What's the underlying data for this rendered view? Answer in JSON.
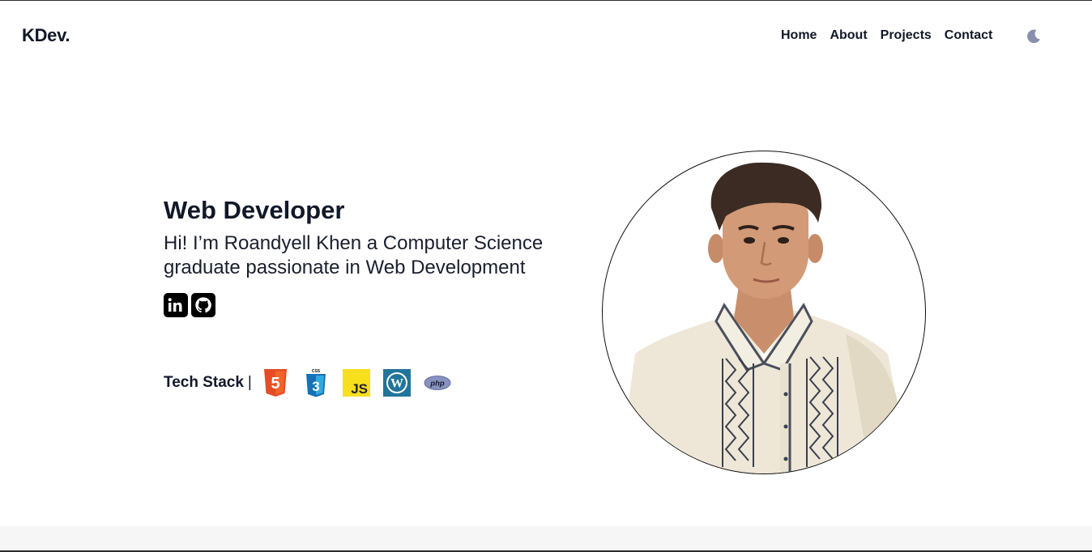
{
  "brand": {
    "logo": "KDev."
  },
  "nav": {
    "items": [
      {
        "label": "Home"
      },
      {
        "label": "About"
      },
      {
        "label": "Projects"
      },
      {
        "label": "Contact"
      }
    ],
    "theme_toggle_icon": "moon-icon"
  },
  "hero": {
    "title": "Web Developer",
    "intro": "Hi! I’m Roandyell Khen a Computer Science graduate passionate in Web Development",
    "socials": [
      {
        "icon": "linkedin-icon",
        "label": "in"
      },
      {
        "icon": "github-icon"
      }
    ],
    "portrait_icon": "profile-photo"
  },
  "tech_stack": {
    "label": "Tech Stack",
    "separator": "|",
    "items": [
      {
        "icon": "html5-icon",
        "badge": "5"
      },
      {
        "icon": "css3-icon",
        "badge": "3",
        "caption": "CSS"
      },
      {
        "icon": "javascript-icon",
        "badge": "JS"
      },
      {
        "icon": "wordpress-icon",
        "badge": "W"
      },
      {
        "icon": "php-icon",
        "badge": "php"
      }
    ]
  },
  "colors": {
    "text": "#111827",
    "moon": "#8a90ab",
    "html5": "#e44d26",
    "css3": "#1572b6",
    "javascript": "#f7df1e",
    "wordpress": "#21759b",
    "php": "#8892bf"
  }
}
